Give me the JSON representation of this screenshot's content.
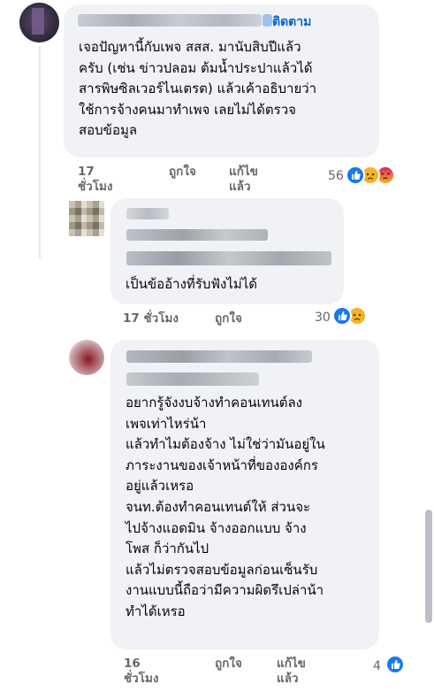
{
  "comments": [
    {
      "follow_label": "ติดตาม",
      "text": "เจอปัญหานี้กับเพจ สสส. มานับสิบปีแล้ว\nครับ (เช่น ข่าวปลอม ต้มน้ำประปาแล้วได้\nสารพิษซิลเวอร์ไนเตรต) แล้วเค้าอธิบายว่า\nใช้การจ้างคนมาทำเพจ เลยไม่ได้ตรวจ\nสอบข้อมูล",
      "time": "17\nชั่วโมง",
      "like_label": "ถูกใจ",
      "edit_label": "แก้ไข\nแล้ว",
      "reaction_count": "56",
      "reactions": [
        "like",
        "sad",
        "angry"
      ]
    },
    {
      "text": "เป็นข้ออ้างที่รับฟังไม่ได้",
      "time": "17 ชั่วโมง",
      "like_label": "ถูกใจ",
      "reaction_count": "30",
      "reactions": [
        "like",
        "sad"
      ]
    },
    {
      "text": "อยากรู้จังงบจ้างทำคอนเทนต์ลง\nเพจเท่าไหร่น้า\nแล้วทำไมต้องจ้าง ไม่ใช่ว่ามันอยู่ใน\nภาระงานของเจ้าหน้าที่ขององค์กร\nอยู่แล้วเหรอ\nจนท.ต้องทำคอนเทนต์ให้ ส่วนจะ\nไปจ้างแอดมิน จ้างออกแบบ จ้าง\nโพส ก็ว่ากันไป\nแล้วไม่ตรวจสอบข้อมูลก่อนเซ็นรับ\nงานแบบนี้ถือว่ามีความผิดรึเปล่าน้า\nทำได้เหรอ",
      "time": "16\nชั่วโมง",
      "like_label": "ถูกใจ",
      "edit_label": "แก้ไข\nแล้ว",
      "reaction_count": "4",
      "reactions": [
        "like"
      ]
    }
  ],
  "colors": {
    "bubble": "#f0f2f5",
    "follow_link": "#0064d1",
    "meta": "#65676b",
    "like": "#1877f2",
    "sad": "#f7b125",
    "angry": "#e9710f"
  }
}
